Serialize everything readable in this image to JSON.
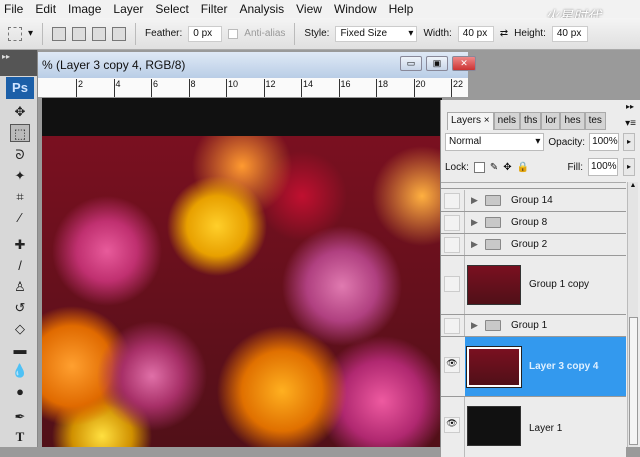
{
  "menu": [
    "File",
    "Edit",
    "Image",
    "Layer",
    "Select",
    "Filter",
    "Analysis",
    "View",
    "Window",
    "Help"
  ],
  "options": {
    "feather_label": "Feather:",
    "feather_value": "0 px",
    "antialias": "Anti-alias",
    "style_label": "Style:",
    "style_value": "Fixed Size",
    "width_label": "Width:",
    "width_value": "40 px",
    "height_label": "Height:",
    "height_value": "40 px"
  },
  "watermark": "火星时代",
  "tools": {
    "logo": "Ps"
  },
  "document": {
    "title": "% (Layer 3 copy 4, RGB/8)",
    "ruler": [
      "2",
      "4",
      "6",
      "8",
      "10",
      "12",
      "14",
      "16",
      "18",
      "20",
      "22"
    ]
  },
  "layers_panel": {
    "tabs": [
      "Layers",
      "nels",
      "ths",
      "lor",
      "hes",
      "tes"
    ],
    "blend_mode": "Normal",
    "opacity_label": "Opacity:",
    "opacity": "100%",
    "lock_label": "Lock:",
    "fill_label": "Fill:",
    "fill": "100%",
    "layers": [
      {
        "name": "Group 14",
        "type": "group",
        "visible": false
      },
      {
        "name": "Group 8",
        "type": "group",
        "visible": false
      },
      {
        "name": "Group 2",
        "type": "group",
        "visible": false
      },
      {
        "name": "Group 1 copy",
        "type": "layer",
        "visible": false
      },
      {
        "name": "Group 1",
        "type": "group",
        "visible": false
      },
      {
        "name": "Layer 3 copy 4",
        "type": "layer",
        "visible": true,
        "selected": true
      },
      {
        "name": "Layer 1",
        "type": "layer",
        "visible": true
      }
    ],
    "selected_color": "#3399ee"
  }
}
